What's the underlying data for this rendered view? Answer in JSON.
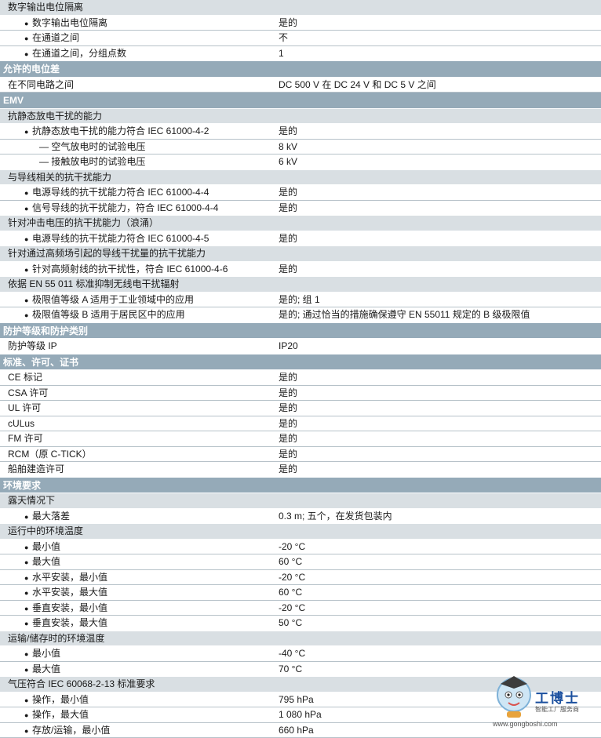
{
  "rows": [
    {
      "t": "sub",
      "label": "数字输出电位隔离"
    },
    {
      "t": "item",
      "level": 2,
      "bullet": "●",
      "label": "数字输出电位隔离",
      "value": "是的"
    },
    {
      "t": "item",
      "level": 2,
      "bullet": "●",
      "label": "在通道之间",
      "value": "不"
    },
    {
      "t": "item",
      "level": 2,
      "bullet": "●",
      "label": "在通道之间，分组点数",
      "value": "1",
      "nb": true
    },
    {
      "t": "group",
      "label": "允许的电位差"
    },
    {
      "t": "item",
      "level": 1,
      "label": "在不同电路之间",
      "value": "DC 500 V 在 DC 24 V 和 DC 5 V 之间"
    },
    {
      "t": "group",
      "label": "EMV"
    },
    {
      "t": "sub",
      "label": "抗静态放电干扰的能力"
    },
    {
      "t": "item",
      "level": 2,
      "bullet": "●",
      "label": "抗静态放电干扰的能力符合 IEC 61000-4-2",
      "value": "是的"
    },
    {
      "t": "item",
      "level": 3,
      "label": "— 空气放电时的试验电压",
      "value": "8 kV"
    },
    {
      "t": "item",
      "level": 3,
      "label": "— 接触放电时的试验电压",
      "value": "6 kV",
      "nb": true
    },
    {
      "t": "sub",
      "label": "与导线相关的抗干扰能力"
    },
    {
      "t": "item",
      "level": 2,
      "bullet": "●",
      "label": "电源导线的抗干扰能力符合 IEC 61000-4-4",
      "value": "是的"
    },
    {
      "t": "item",
      "level": 2,
      "bullet": "●",
      "label": "信号导线的抗干扰能力，符合 IEC 61000-4-4",
      "value": "是的",
      "nb": true
    },
    {
      "t": "sub",
      "label": "针对冲击电压的抗干扰能力（浪涌）"
    },
    {
      "t": "item",
      "level": 2,
      "bullet": "●",
      "label": "电源导线的抗干扰能力符合 IEC 61000-4-5",
      "value": "是的",
      "nb": true
    },
    {
      "t": "sub",
      "label": "针对通过高频场引起的导线干扰量的抗干扰能力"
    },
    {
      "t": "item",
      "level": 2,
      "bullet": "●",
      "label": "针对高频射线的抗干扰性，符合 IEC 61000-4-6",
      "value": "是的",
      "nb": true
    },
    {
      "t": "sub",
      "label": "依据 EN 55 011 标准抑制无线电干扰辐射"
    },
    {
      "t": "item",
      "level": 2,
      "bullet": "●",
      "label": "极限值等级 A 适用于工业领域中的应用",
      "value": "是的; 组 1"
    },
    {
      "t": "item",
      "level": 2,
      "bullet": "●",
      "label": "极限值等级 B 适用于居民区中的应用",
      "value": "是的; 通过恰当的措施确保遵守 EN 55011 规定的 B 级极限值",
      "nb": true
    },
    {
      "t": "group",
      "label": "防护等级和防护类别"
    },
    {
      "t": "item",
      "level": 1,
      "label": "防护等级 IP",
      "value": "IP20",
      "nb": true
    },
    {
      "t": "group",
      "label": "标准、许可、证书"
    },
    {
      "t": "item",
      "level": 2,
      "label": "CE 标记",
      "value": "是的",
      "pad": "l1"
    },
    {
      "t": "item",
      "level": 1,
      "label": "CSA 许可",
      "value": "是的"
    },
    {
      "t": "item",
      "level": 1,
      "label": "UL 许可",
      "value": "是的"
    },
    {
      "t": "item",
      "level": 1,
      "label": "cULus",
      "value": "是的"
    },
    {
      "t": "item",
      "level": 1,
      "label": "FM 许可",
      "value": "是的"
    },
    {
      "t": "item",
      "level": 1,
      "label": "RCM（原 C-TICK）",
      "value": "是的"
    },
    {
      "t": "item",
      "level": 1,
      "label": "船舶建造许可",
      "value": "是的",
      "nb": true
    },
    {
      "t": "group",
      "label": "环境要求"
    },
    {
      "t": "sub",
      "label": "露天情况下"
    },
    {
      "t": "item",
      "level": 2,
      "bullet": "●",
      "label": "最大落差",
      "value": "0.3 m; 五个，在发货包装内",
      "nb": true
    },
    {
      "t": "sub",
      "label": "运行中的环境温度"
    },
    {
      "t": "item",
      "level": 2,
      "bullet": "●",
      "label": "最小值",
      "value": "-20 °C"
    },
    {
      "t": "item",
      "level": 2,
      "bullet": "●",
      "label": "最大值",
      "value": "60 °C"
    },
    {
      "t": "item",
      "level": 2,
      "bullet": "●",
      "label": "水平安装，最小值",
      "value": "-20 °C"
    },
    {
      "t": "item",
      "level": 2,
      "bullet": "●",
      "label": "水平安装，最大值",
      "value": "60 °C"
    },
    {
      "t": "item",
      "level": 2,
      "bullet": "●",
      "label": "垂直安装，最小值",
      "value": "-20 °C"
    },
    {
      "t": "item",
      "level": 2,
      "bullet": "●",
      "label": "垂直安装，最大值",
      "value": "50 °C",
      "nb": true
    },
    {
      "t": "sub",
      "label": "运输/储存时的环境温度"
    },
    {
      "t": "item",
      "level": 2,
      "bullet": "●",
      "label": "最小值",
      "value": "-40 °C"
    },
    {
      "t": "item",
      "level": 2,
      "bullet": "●",
      "label": "最大值",
      "value": "70 °C",
      "nb": true
    },
    {
      "t": "sub",
      "label": "气压符合 IEC 60068-2-13 标准要求"
    },
    {
      "t": "item",
      "level": 2,
      "bullet": "●",
      "label": "操作，最小值",
      "value": "795 hPa"
    },
    {
      "t": "item",
      "level": 2,
      "bullet": "●",
      "label": "操作，最大值",
      "value": "1 080 hPa"
    },
    {
      "t": "item",
      "level": 2,
      "bullet": "●",
      "label": "存放/运输，最小值",
      "value": "660 hPa"
    }
  ],
  "watermark": {
    "brand": "工博士",
    "tagline": "智能工厂服务商",
    "url": "www.gongboshi.com"
  },
  "colors": {
    "group_bg": "#95aab8",
    "sub_bg": "#d9dfe3",
    "row_rule": "#b7c2c9"
  }
}
